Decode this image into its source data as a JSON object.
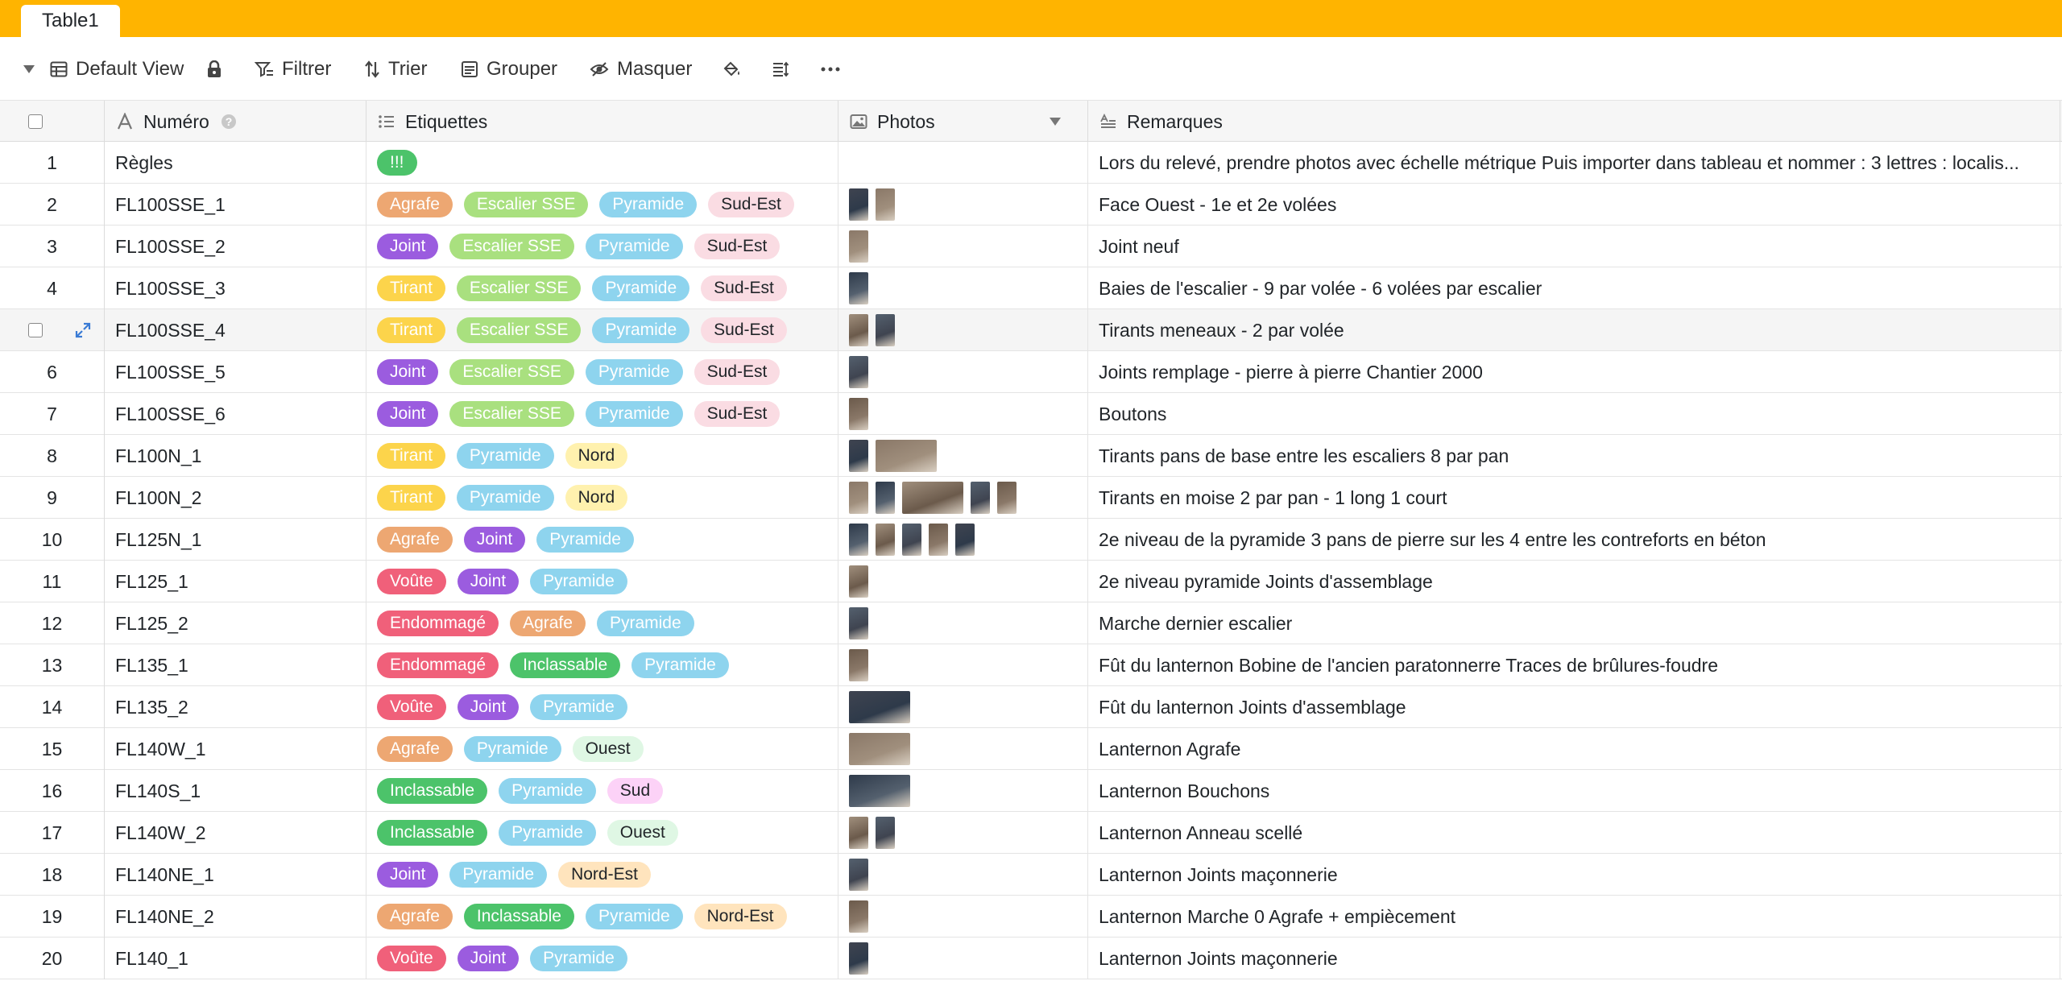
{
  "tab": {
    "label": "Table1"
  },
  "toolbar": {
    "view": "Default View",
    "filter": "Filtrer",
    "sort": "Trier",
    "group": "Grouper",
    "hide": "Masquer"
  },
  "columns": {
    "numero": "Numéro",
    "etiquettes": "Etiquettes",
    "photos": "Photos",
    "remarques": "Remarques"
  },
  "colors": {
    "topbar": "#ffb400",
    "Agrafe": "#eda772",
    "Joint": "#9b5cdf",
    "Tirant": "#fcd44b",
    "Voûte": "#f0607a",
    "Endommagé": "#f0607a",
    "Inclassable": "#4cc36a",
    "!!!": "#4cc36a",
    "Escalier SSE": "#a9e07f",
    "Pyramide": "#8ed4ee",
    "Sud-Est": "#fadce3",
    "Nord": "#fff1ae",
    "Ouest": "#dff7e4",
    "Sud": "#fcd2f7",
    "Nord-Est": "#ffe4bd"
  },
  "rows": [
    {
      "idx": "1",
      "num": "Règles",
      "tags": [
        "!!!"
      ],
      "photos": [],
      "rem": "Lors du relevé, prendre photos avec échelle métrique Puis importer dans tableau et nommer : 3 lettres : localis..."
    },
    {
      "idx": "2",
      "num": "FL100SSE_1",
      "tags": [
        "Agrafe",
        "Escalier SSE",
        "Pyramide",
        "Sud-Est"
      ],
      "photos": [
        "p",
        "p"
      ],
      "rem": "Face Ouest - 1e et 2e volées"
    },
    {
      "idx": "3",
      "num": "FL100SSE_2",
      "tags": [
        "Joint",
        "Escalier SSE",
        "Pyramide",
        "Sud-Est"
      ],
      "photos": [
        "p"
      ],
      "rem": "Joint neuf"
    },
    {
      "idx": "4",
      "num": "FL100SSE_3",
      "tags": [
        "Tirant",
        "Escalier SSE",
        "Pyramide",
        "Sud-Est"
      ],
      "photos": [
        "p"
      ],
      "rem": "Baies de l'escalier - 9 par volée - 6 volées par escalier"
    },
    {
      "idx": "",
      "num": "FL100SSE_4",
      "tags": [
        "Tirant",
        "Escalier SSE",
        "Pyramide",
        "Sud-Est"
      ],
      "photos": [
        "p",
        "p"
      ],
      "rem": "Tirants meneaux - 2 par volée"
    },
    {
      "idx": "6",
      "num": "FL100SSE_5",
      "tags": [
        "Joint",
        "Escalier SSE",
        "Pyramide",
        "Sud-Est"
      ],
      "photos": [
        "p"
      ],
      "rem": "Joints remplage - pierre à pierre Chantier 2000"
    },
    {
      "idx": "7",
      "num": "FL100SSE_6",
      "tags": [
        "Joint",
        "Escalier SSE",
        "Pyramide",
        "Sud-Est"
      ],
      "photos": [
        "p"
      ],
      "rem": "Boutons"
    },
    {
      "idx": "8",
      "num": "FL100N_1",
      "tags": [
        "Tirant",
        "Pyramide",
        "Nord"
      ],
      "photos": [
        "p",
        "l"
      ],
      "rem": "Tirants pans de base entre les escaliers 8 par pan"
    },
    {
      "idx": "9",
      "num": "FL100N_2",
      "tags": [
        "Tirant",
        "Pyramide",
        "Nord"
      ],
      "photos": [
        "p",
        "p",
        "l",
        "p",
        "p"
      ],
      "rem": "Tirants en moise 2 par pan - 1 long 1 court"
    },
    {
      "idx": "10",
      "num": "FL125N_1",
      "tags": [
        "Agrafe",
        "Joint",
        "Pyramide"
      ],
      "photos": [
        "p",
        "p",
        "p",
        "p",
        "p"
      ],
      "rem": "2e niveau de la pyramide 3 pans de pierre sur les 4 entre les contreforts en béton"
    },
    {
      "idx": "11",
      "num": "FL125_1",
      "tags": [
        "Voûte",
        "Joint",
        "Pyramide"
      ],
      "photos": [
        "p"
      ],
      "rem": "2e niveau pyramide Joints d'assemblage"
    },
    {
      "idx": "12",
      "num": "FL125_2",
      "tags": [
        "Endommagé",
        "Agrafe",
        "Pyramide"
      ],
      "photos": [
        "p"
      ],
      "rem": "Marche dernier escalier"
    },
    {
      "idx": "13",
      "num": "FL135_1",
      "tags": [
        "Endommagé",
        "Inclassable",
        "Pyramide"
      ],
      "photos": [
        "p"
      ],
      "rem": "Fût du lanternon Bobine de l'ancien paratonnerre Traces de brûlures-foudre"
    },
    {
      "idx": "14",
      "num": "FL135_2",
      "tags": [
        "Voûte",
        "Joint",
        "Pyramide"
      ],
      "photos": [
        "l"
      ],
      "rem": "Fût du lanternon Joints d'assemblage"
    },
    {
      "idx": "15",
      "num": "FL140W_1",
      "tags": [
        "Agrafe",
        "Pyramide",
        "Ouest"
      ],
      "photos": [
        "l"
      ],
      "rem": "Lanternon Agrafe"
    },
    {
      "idx": "16",
      "num": "FL140S_1",
      "tags": [
        "Inclassable",
        "Pyramide",
        "Sud"
      ],
      "photos": [
        "l"
      ],
      "rem": "Lanternon Bouchons"
    },
    {
      "idx": "17",
      "num": "FL140W_2",
      "tags": [
        "Inclassable",
        "Pyramide",
        "Ouest"
      ],
      "photos": [
        "p",
        "p"
      ],
      "rem": "Lanternon Anneau scellé"
    },
    {
      "idx": "18",
      "num": "FL140NE_1",
      "tags": [
        "Joint",
        "Pyramide",
        "Nord-Est"
      ],
      "photos": [
        "p"
      ],
      "rem": "Lanternon Joints maçonnerie"
    },
    {
      "idx": "19",
      "num": "FL140NE_2",
      "tags": [
        "Agrafe",
        "Inclassable",
        "Pyramide",
        "Nord-Est"
      ],
      "photos": [
        "p"
      ],
      "rem": "Lanternon Marche 0 Agrafe + empiècement"
    },
    {
      "idx": "20",
      "num": "FL140_1",
      "tags": [
        "Voûte",
        "Joint",
        "Pyramide"
      ],
      "photos": [
        "p"
      ],
      "rem": "Lanternon Joints maçonnerie"
    }
  ]
}
